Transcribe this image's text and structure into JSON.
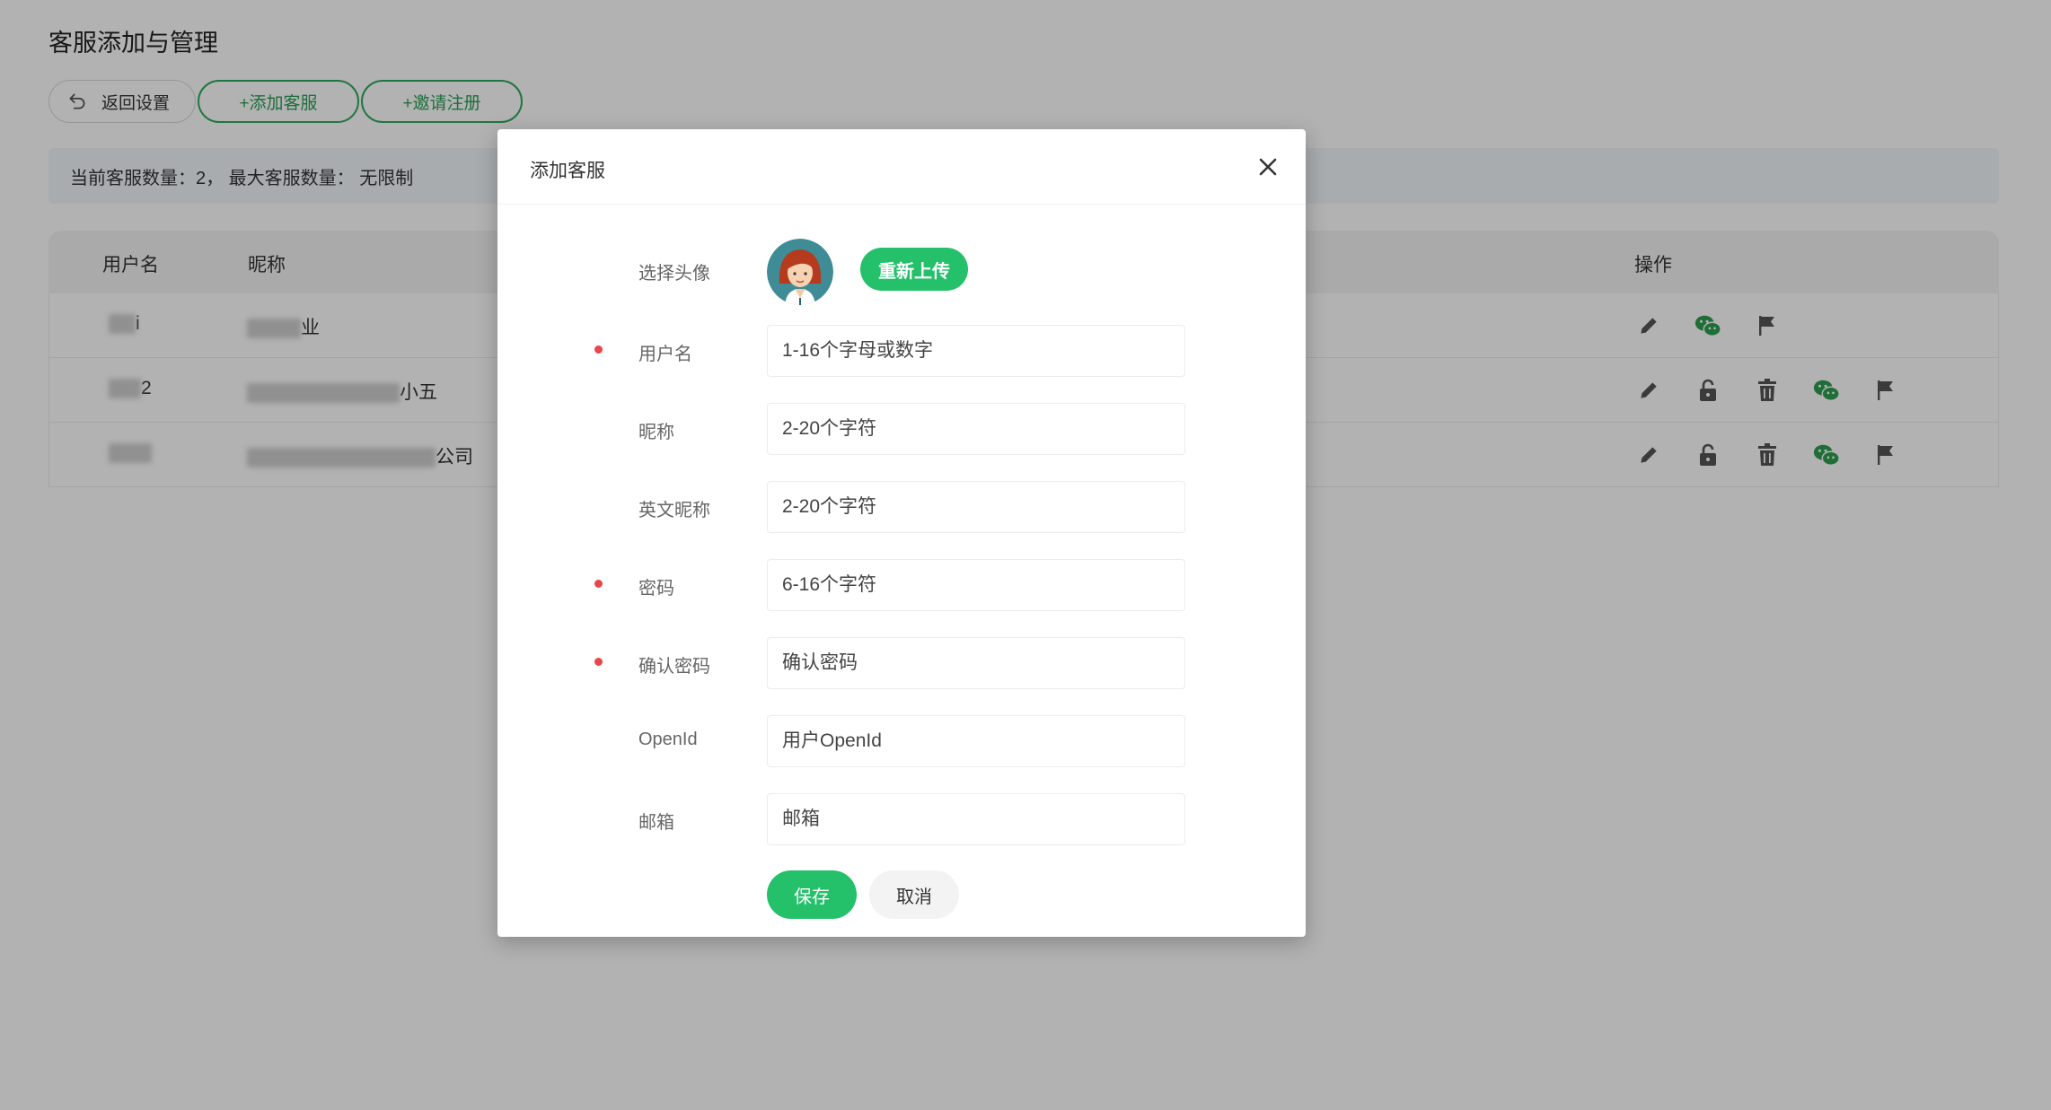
{
  "page": {
    "title": "客服添加与管理"
  },
  "toolbar": {
    "back_label": "返回设置",
    "add_label": "+添加客服",
    "invite_label": "+邀请注册"
  },
  "info": {
    "text": "当前客服数量：2， 最大客服数量： 无限制"
  },
  "table": {
    "columns": [
      "用户名",
      "昵称",
      "操作"
    ],
    "rows": [
      {
        "user_suffix": "i",
        "nick_suffix": "业",
        "ops": [
          "edit-icon",
          "wechat-icon",
          "flag-icon"
        ]
      },
      {
        "user_suffix": "2",
        "nick_suffix": "小五",
        "ops": [
          "edit-icon",
          "unlock-icon",
          "trash-icon",
          "wechat-icon",
          "flag-icon"
        ]
      },
      {
        "user_suffix": "",
        "nick_suffix": "公司",
        "ops": [
          "edit-icon",
          "unlock-icon",
          "trash-icon",
          "wechat-icon",
          "flag-icon"
        ]
      }
    ]
  },
  "modal": {
    "title": "添加客服",
    "avatar_label": "选择头像",
    "upload_label": "重新上传",
    "fields": [
      {
        "label": "用户名",
        "placeholder": "1-16个字母或数字",
        "required": true
      },
      {
        "label": "昵称",
        "placeholder": "2-20个字符",
        "required": false
      },
      {
        "label": "英文昵称",
        "placeholder": "2-20个字符",
        "required": false
      },
      {
        "label": "密码",
        "placeholder": "6-16个字符",
        "required": true
      },
      {
        "label": "确认密码",
        "placeholder": "确认密码",
        "required": true
      },
      {
        "label": "OpenId",
        "placeholder": "用户OpenId",
        "required": false
      },
      {
        "label": "邮箱",
        "placeholder": "邮箱",
        "required": false
      }
    ],
    "save_label": "保存",
    "cancel_label": "取消"
  },
  "colors": {
    "accent": "#25c06a",
    "accent_border": "#2eaa5e",
    "required_dot": "#e9454a",
    "info_bg": "#f1f6fb"
  }
}
